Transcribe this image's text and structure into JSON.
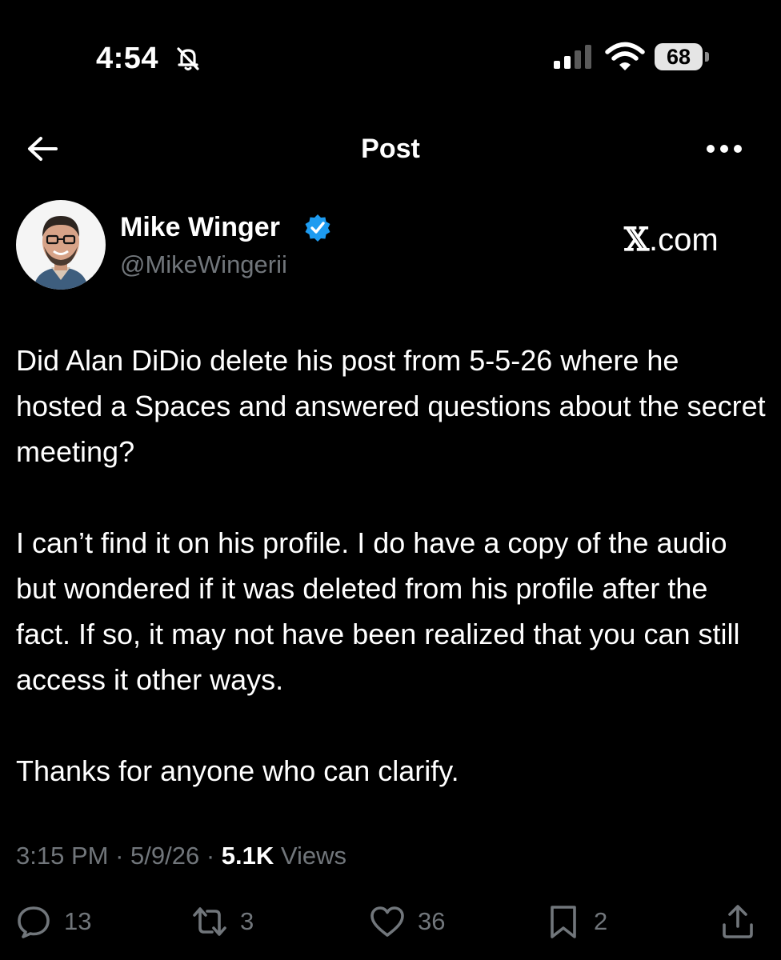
{
  "status_bar": {
    "time": "4:54",
    "battery": "68",
    "icons": [
      "bell-slash-icon",
      "signal-icon",
      "wifi-icon",
      "battery-icon"
    ]
  },
  "header": {
    "title": "Post",
    "back_icon": "arrow-left-icon",
    "more_icon": "more-horizontal-icon"
  },
  "author": {
    "name": "Mike Winger",
    "handle": "@MikeWingerii",
    "verified_icon": "verified-badge-icon",
    "verified_color": "#1d9bf0"
  },
  "brand": {
    "x": "𝕏",
    "suffix": ".com"
  },
  "post": {
    "paragraphs": [
      "Did Alan DiDio delete his post from 5-5-26 where he hosted a Spaces and answered questions about the secret meeting?",
      "I can’t find it on his profile. I do have a copy of the audio but wondered if it was deleted from his profile after the fact. If so, it may not have been realized that you can still access it other ways.",
      "Thanks for anyone who can clarify."
    ]
  },
  "meta": {
    "time": "3:15 PM",
    "sep1": " · ",
    "date": "5/9/26",
    "sep2": " · ",
    "views_count": "5.1K",
    "views_label": " Views"
  },
  "actions": {
    "replies": "13",
    "reposts": "3",
    "likes": "36",
    "bookmarks": "2"
  },
  "colors": {
    "background": "#000000",
    "text": "#ffffff",
    "muted": "#71767b",
    "accent": "#1d9bf0"
  }
}
